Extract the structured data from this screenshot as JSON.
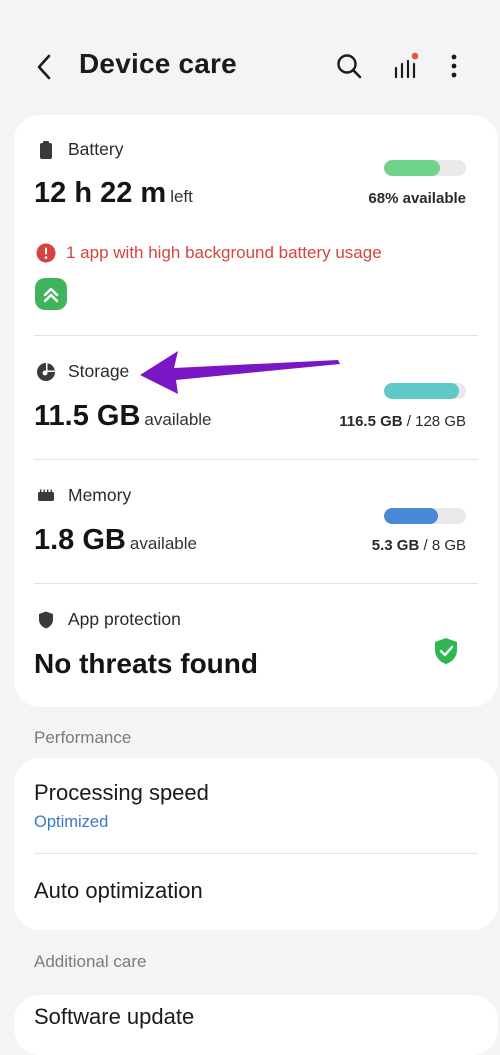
{
  "header": {
    "title": "Device care",
    "icons": [
      "back-icon",
      "search-icon",
      "stats-icon",
      "more-icon"
    ]
  },
  "battery": {
    "label": "Battery",
    "value": "12 h 22 m",
    "suffix": "left",
    "stat": "68% available",
    "level": 0.68,
    "bar_color": "#6fd389",
    "warning": "1 app with high background battery usage"
  },
  "storage": {
    "label": "Storage",
    "value": "11.5 GB",
    "suffix": "available",
    "stat_used": "116.5 GB",
    "stat_total": " / 128 GB",
    "level": 0.91,
    "bar_color": "#5ec9c7"
  },
  "memory": {
    "label": "Memory",
    "value": "1.8 GB",
    "suffix": "available",
    "stat_used": "5.3 GB",
    "stat_total": " / 8 GB",
    "level": 0.66,
    "bar_color": "#4a87d6"
  },
  "protection": {
    "label": "App protection",
    "value": "No threats found",
    "shield_color": "#2db852"
  },
  "performance": {
    "section": "Performance",
    "processing_title": "Processing speed",
    "processing_sub": "Optimized",
    "auto_title": "Auto optimization"
  },
  "additional": {
    "section": "Additional care",
    "software_title": "Software update"
  },
  "annotation_color": "#7a16c4"
}
